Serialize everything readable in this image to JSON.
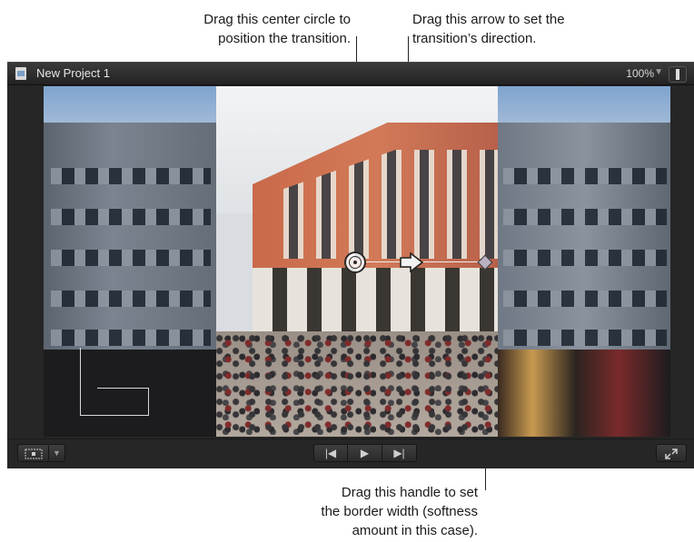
{
  "callouts": {
    "center_circle": "Drag this center circle to\nposition the transition.",
    "arrow": "Drag this arrow to set the\ntransition’s direction.",
    "handle": "Drag this handle to set\nthe border width (softness\namount in this case)."
  },
  "window": {
    "title": "New Project 1",
    "zoom": "100%"
  },
  "icons": {
    "document": "document-icon",
    "zoom_caret": "chevron-down-icon",
    "view_options": "view-options-icon",
    "transform": "transform-icon",
    "transform_menu": "chevron-down-icon",
    "prev": "skip-back-icon",
    "play": "play-icon",
    "next": "skip-forward-icon",
    "fullscreen": "fullscreen-icon"
  },
  "playback": {
    "prev_glyph": "|◀",
    "play_glyph": "▶",
    "next_glyph": "▶|"
  }
}
